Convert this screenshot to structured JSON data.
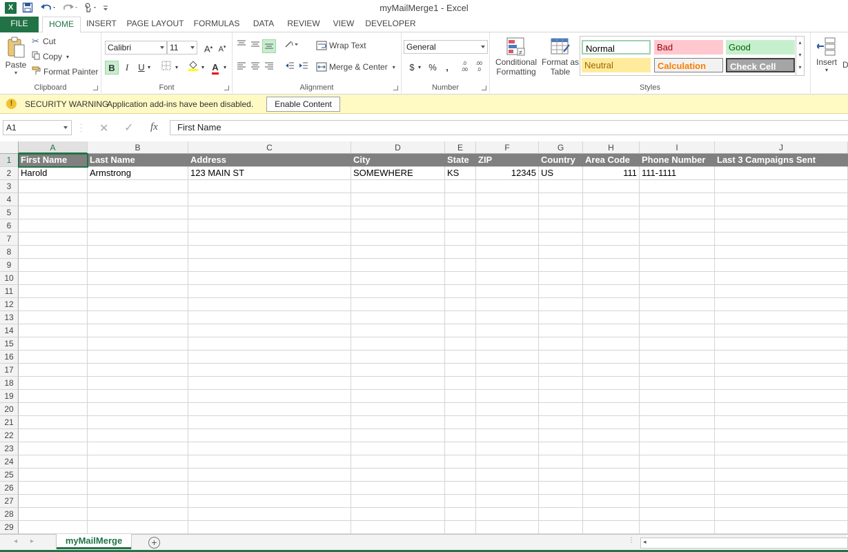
{
  "window": {
    "title": "myMailMerge1 - Excel"
  },
  "qat": {
    "logo": "X",
    "icons": [
      "save-icon",
      "undo-icon",
      "redo-icon",
      "touch-mode-icon",
      "customize-qat-icon"
    ]
  },
  "tabs": [
    "FILE",
    "HOME",
    "INSERT",
    "PAGE LAYOUT",
    "FORMULAS",
    "DATA",
    "REVIEW",
    "VIEW",
    "DEVELOPER"
  ],
  "ribbon": {
    "clipboard": {
      "label": "Clipboard",
      "paste": "Paste",
      "cut": "Cut",
      "copy": "Copy",
      "format_painter": "Format Painter"
    },
    "font": {
      "label": "Font",
      "name": "Calibri",
      "size": "11",
      "bold": "B",
      "italic": "I",
      "underline": "U",
      "grow": "A",
      "shrink": "A",
      "color_a": "A"
    },
    "alignment": {
      "label": "Alignment",
      "wrap_text": "Wrap Text",
      "merge_center": "Merge & Center"
    },
    "number": {
      "label": "Number",
      "format": "General",
      "currency": "$",
      "percent": "%",
      "comma": ",",
      "inc_dec": ".0\n.00",
      "dec_dec": ".00\n.0"
    },
    "styles": {
      "label": "Styles",
      "conditional": [
        "Conditional",
        "Formatting"
      ],
      "format_table": [
        "Format as",
        "Table"
      ],
      "cells": [
        {
          "name": "Normal",
          "bg": "#ffffff",
          "fg": "#000000"
        },
        {
          "name": "Bad",
          "bg": "#ffc7ce",
          "fg": "#9c0006"
        },
        {
          "name": "Good",
          "bg": "#c6efce",
          "fg": "#006100"
        },
        {
          "name": "Neutral",
          "bg": "#ffeb9c",
          "fg": "#9c6500"
        },
        {
          "name": "Calculation",
          "bg": "#f2f2f2",
          "fg": "#fa7d00"
        },
        {
          "name": "Check Cell",
          "bg": "#a5a5a5",
          "fg": "#ffffff"
        }
      ]
    },
    "cells": {
      "insert": "Insert",
      "d": "D"
    }
  },
  "security": {
    "title": "SECURITY WARNING",
    "message": "Application add-ins have been disabled.",
    "button": "Enable Content",
    "icon": "!"
  },
  "formula_bar": {
    "name_box": "A1",
    "fx": "fx",
    "formula": "First Name"
  },
  "sheet": {
    "columns": [
      "A",
      "B",
      "C",
      "D",
      "E",
      "F",
      "G",
      "H",
      "I",
      "J"
    ],
    "header_row": [
      "First Name",
      "Last Name",
      "Address",
      "City",
      "State",
      "ZIP",
      "Country",
      "Area Code",
      "Phone Number",
      "Last 3 Campaigns Sent"
    ],
    "data_rows": [
      [
        "Harold",
        "Armstrong",
        "123 MAIN ST",
        "SOMEWHERE",
        "KS",
        "12345",
        "US",
        "111",
        "111-1111",
        ""
      ]
    ],
    "numeric_columns": [
      5,
      7
    ],
    "row_numbers": [
      "1",
      "2",
      "3",
      "4",
      "5",
      "6",
      "7",
      "8",
      "9",
      "10",
      "11",
      "12",
      "13",
      "14",
      "15",
      "16",
      "17",
      "18",
      "19",
      "20",
      "21",
      "22",
      "23",
      "24",
      "25",
      "26",
      "27",
      "28",
      "29"
    ],
    "selected_cell": "A1",
    "header_bg": "#808080"
  },
  "sheet_tabs": {
    "active": "myMailMerge",
    "add": "+"
  },
  "accent": "#217346"
}
